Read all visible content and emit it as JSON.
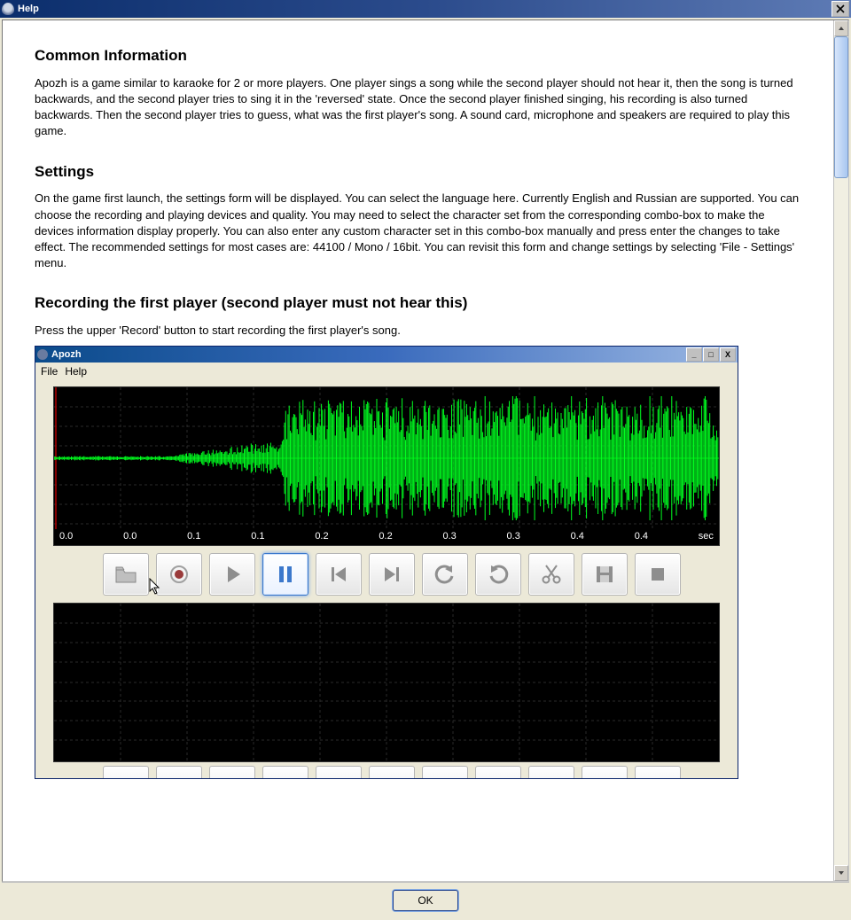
{
  "window": {
    "title": "Help",
    "close_x": "X"
  },
  "help": {
    "h1": "Common Information",
    "p1": "Apozh is a game similar to karaoke for 2 or more players. One player sings a song while the second player should not hear it, then the song is turned backwards, and the second player tries to sing it in the 'reversed' state. Once the second player finished singing, his recording is also turned backwards. Then the second player tries to guess, what was the first player's song. A sound card, microphone and speakers are required to play this game.",
    "h2": "Settings",
    "p2": "On the game first launch, the settings form will be displayed. You can select the language here. Currently English and Russian are supported. You can choose the recording and playing devices and quality. You may need to select the character set from the corresponding combo-box to make the devices information display properly. You can also enter any custom character set in this combo-box manually and press enter the changes to take effect. The recommended settings for most cases are: 44100 / Mono / 16bit. You can revisit this form and change settings by selecting 'File - Settings' menu.",
    "h3": "Recording the first player (second player must not hear this)",
    "p3": "Press the upper 'Record' button to start recording the first player's song."
  },
  "inner": {
    "title": "Apozh",
    "menu_file": "File",
    "menu_help": "Help",
    "axis": [
      "0.0",
      "0.0",
      "0.1",
      "0.1",
      "0.2",
      "0.2",
      "0.3",
      "0.3",
      "0.4",
      "0.4",
      "sec"
    ]
  },
  "toolbar_icons": {
    "open": "open",
    "record": "record",
    "play": "play",
    "pause": "pause",
    "skip_start": "skip-start",
    "skip_end": "skip-end",
    "undo": "undo",
    "redo": "redo",
    "cut": "cut",
    "save": "save",
    "stop": "stop"
  },
  "buttons": {
    "ok": "OK"
  }
}
